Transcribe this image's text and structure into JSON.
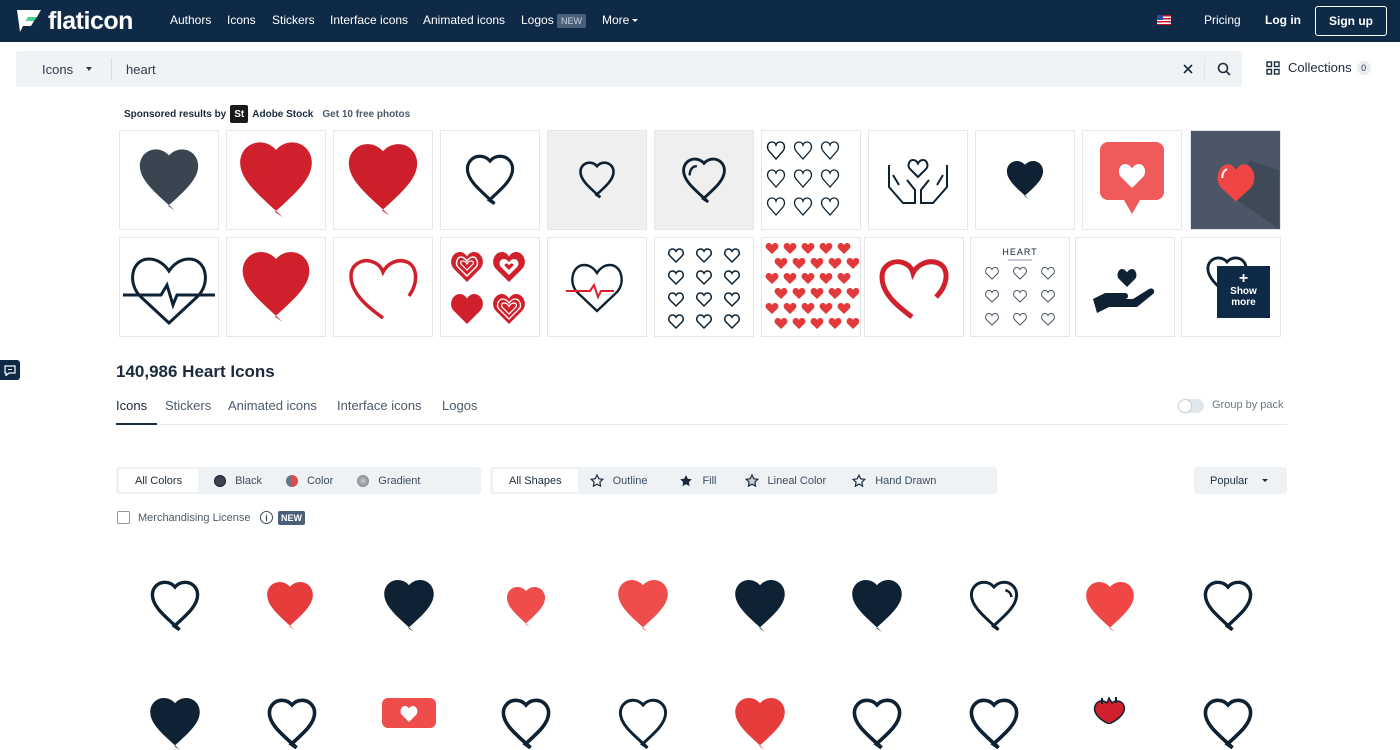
{
  "nav": {
    "logo_text": "flaticon",
    "items": [
      "Authors",
      "Icons",
      "Stickers",
      "Interface icons",
      "Animated icons",
      "Logos",
      "More"
    ],
    "new_badge": "NEW",
    "pricing": "Pricing",
    "login": "Log in",
    "signup": "Sign up"
  },
  "search": {
    "type": "Icons",
    "value": "heart",
    "collections_label": "Collections",
    "collections_count": "0"
  },
  "sponsored": {
    "label": "Sponsored results by",
    "brand_badge": "St",
    "brand": "Adobe Stock",
    "offer": "Get 10 free photos",
    "show_more": "Show more",
    "show_more_plus": "+",
    "sheet_title": "HEART"
  },
  "results": {
    "title": "140,986 Heart Icons",
    "tabs": [
      "Icons",
      "Stickers",
      "Animated icons",
      "Interface icons",
      "Logos"
    ],
    "active_tab": "Icons",
    "group_by_pack": "Group by pack"
  },
  "filters": {
    "colors": [
      {
        "label": "All Colors",
        "active": true
      },
      {
        "label": "Black",
        "icon": "black-dot-icon"
      },
      {
        "label": "Color",
        "icon": "color-dot-icon"
      },
      {
        "label": "Gradient",
        "icon": "gradient-dot-icon"
      }
    ],
    "shapes": [
      {
        "label": "All Shapes",
        "active": true
      },
      {
        "label": "Outline",
        "icon": "star-outline-icon"
      },
      {
        "label": "Fill",
        "icon": "star-fill-icon"
      },
      {
        "label": "Lineal Color",
        "icon": "star-lineal-icon"
      },
      {
        "label": "Hand Drawn",
        "icon": "star-hand-drawn-icon"
      }
    ],
    "sort": "Popular"
  },
  "license": {
    "label": "Merchandising License",
    "info_glyph": "i",
    "badge": "NEW"
  },
  "colors": {
    "navy": "#0e2a47",
    "red": "#d0202b",
    "coral": "#ef4c4c",
    "dark": "#0e2233",
    "slate": "#4a5666"
  },
  "result_icons": [
    "heart-outline-icon",
    "heart-red-fill-icon",
    "heart-navy-fill-icon",
    "heart-coral-small-icon",
    "heart-coral-fill-icon",
    "heart-navy-fill-icon",
    "heart-navy-fill-icon",
    "heart-outline-shine-icon",
    "heart-coral-fill-icon",
    "heart-outline-icon"
  ]
}
